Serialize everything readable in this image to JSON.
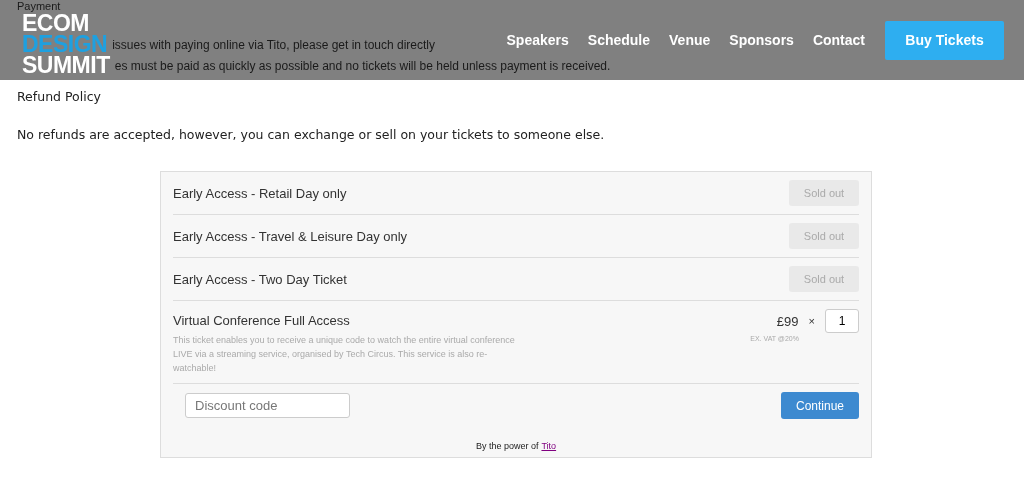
{
  "payment_section": {
    "heading": "Payment",
    "lines": [
      "issues with paying online via Tito, please get in touch directly",
      "es must be paid as quickly as possible and no tickets will be held unless payment is received."
    ]
  },
  "header": {
    "logo": [
      "ECOM",
      "DESIGN",
      "SUMMIT"
    ],
    "nav": [
      "Speakers",
      "Schedule",
      "Venue",
      "Sponsors",
      "Contact"
    ],
    "cta": "Buy Tickets"
  },
  "refund": {
    "heading": "Refund Policy",
    "text": "No refunds are accepted, however, you can exchange or sell on your tickets to someone else."
  },
  "tickets": [
    {
      "kind": "soldout",
      "name": "Early Access - Retail Day only",
      "status": "Sold out"
    },
    {
      "kind": "soldout",
      "name": "Early Access - Travel & Leisure Day only",
      "status": "Sold out"
    },
    {
      "kind": "soldout",
      "name": "Early Access - Two Day Ticket",
      "status": "Sold out"
    },
    {
      "kind": "available",
      "name": "Virtual Conference Full Access",
      "description": "This ticket enables you to receive a unique code to watch the entire virtual conference LIVE via a streaming service, organised by Tech Circus. This service is also re-watchable!",
      "price": "£99",
      "times": "×",
      "quantity": "1",
      "tax_note": "EX. VAT @20%"
    }
  ],
  "discount": {
    "placeholder": "Discount code"
  },
  "continue_button": "Continue",
  "footer": {
    "text": "By the power of",
    "link": "Tito"
  }
}
